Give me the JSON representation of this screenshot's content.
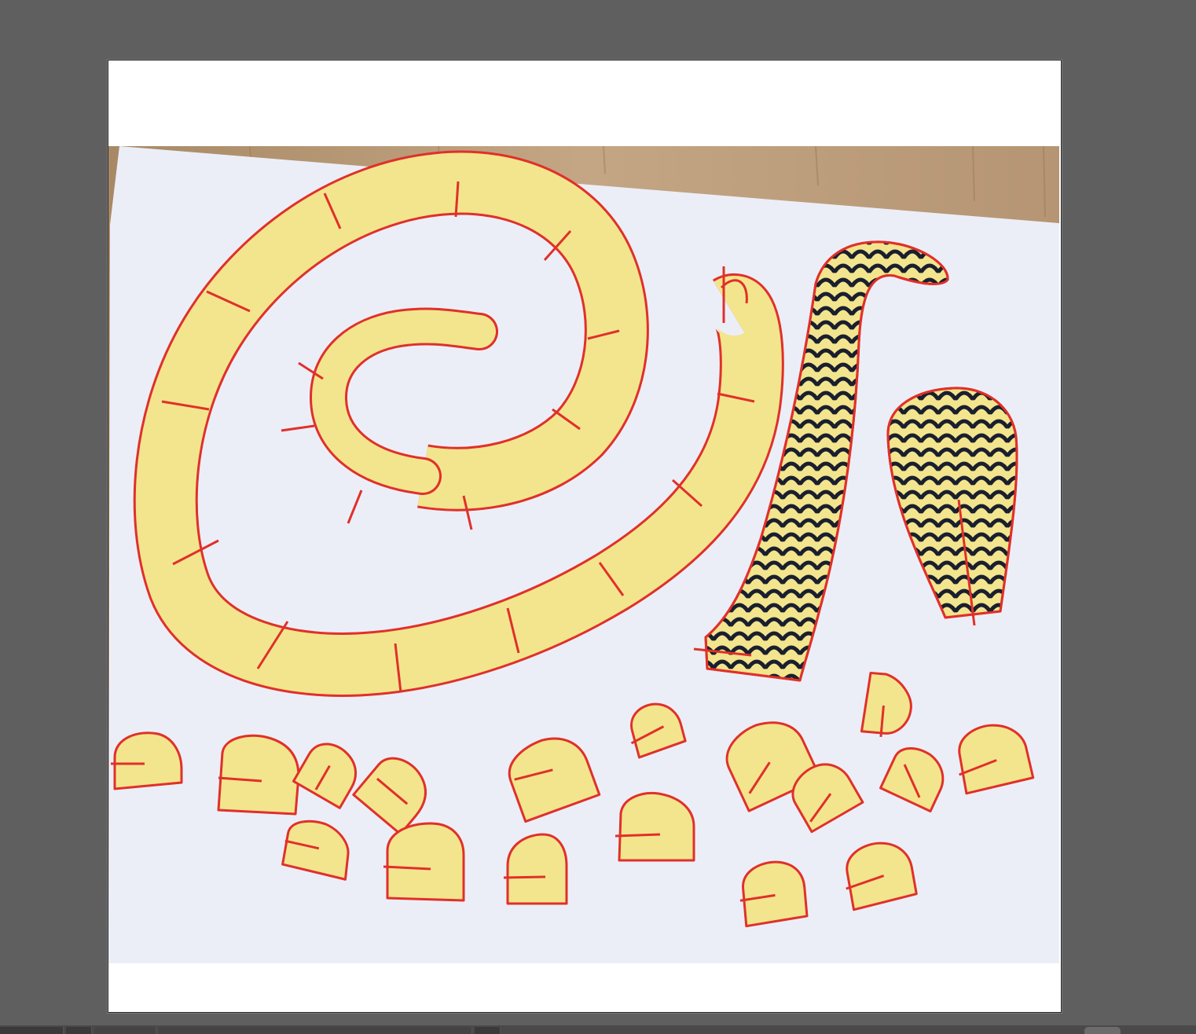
{
  "canvas": {
    "background": "#5f5f5f",
    "artboard_fill": "#ffffff"
  },
  "image": {
    "table_color": "#b89a78",
    "paper_color": "#eceef7",
    "piece_fill": "#f3e58d",
    "outline_color": "#e0302a",
    "pattern_color": "#1a1f2e"
  }
}
